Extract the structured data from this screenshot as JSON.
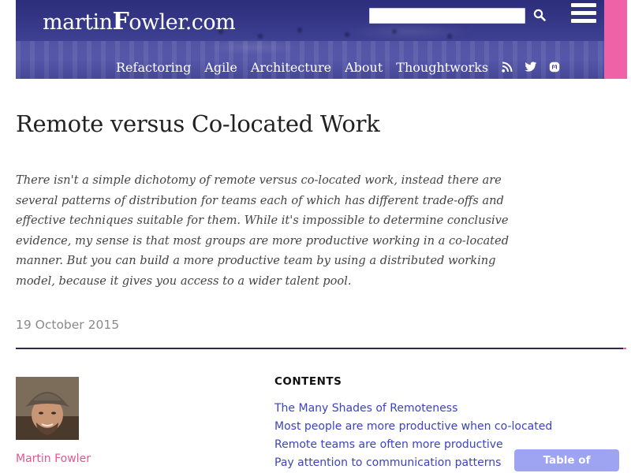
{
  "header": {
    "logo_prefix": "martin",
    "logo_f": "F",
    "logo_suffix": "owler.com",
    "search": {
      "value": "",
      "placeholder": ""
    },
    "nav": {
      "items": [
        "Refactoring",
        "Agile",
        "Architecture",
        "About",
        "Thoughtworks"
      ],
      "icons": [
        "rss-icon",
        "twitter-icon",
        "mastodon-icon"
      ]
    },
    "menu_icon": "hamburger-menu-icon"
  },
  "article": {
    "title": "Remote versus Co-located Work",
    "abstract": "There isn't a simple dichotomy of remote versus co-located work, instead there are several patterns of distribution for teams each of which has different trade-offs and effective techniques suitable for them. While it's impossible to determine conclusive evidence, my sense is that most groups are more productive working in a co-located manner. But you can build a more productive team by using a distributed working model, because it gives you access to a wider talent pool.",
    "date": "19 October 2015"
  },
  "author": {
    "name": "Martin Fowler"
  },
  "contents": {
    "heading": "CONTENTS",
    "items": [
      "The Many Shades of Remoteness",
      "Most people are more productive when co-located",
      "Remote teams are often more productive",
      "Pay attention to communication patterns"
    ],
    "toc_button": "Table of Contents"
  },
  "colors": {
    "banner": "#3b3d8f",
    "accent_pink": "#f062a8",
    "link_blue": "#3c43c0",
    "toc_button": "#9ea3f2",
    "author_pink": "#e0578f"
  }
}
